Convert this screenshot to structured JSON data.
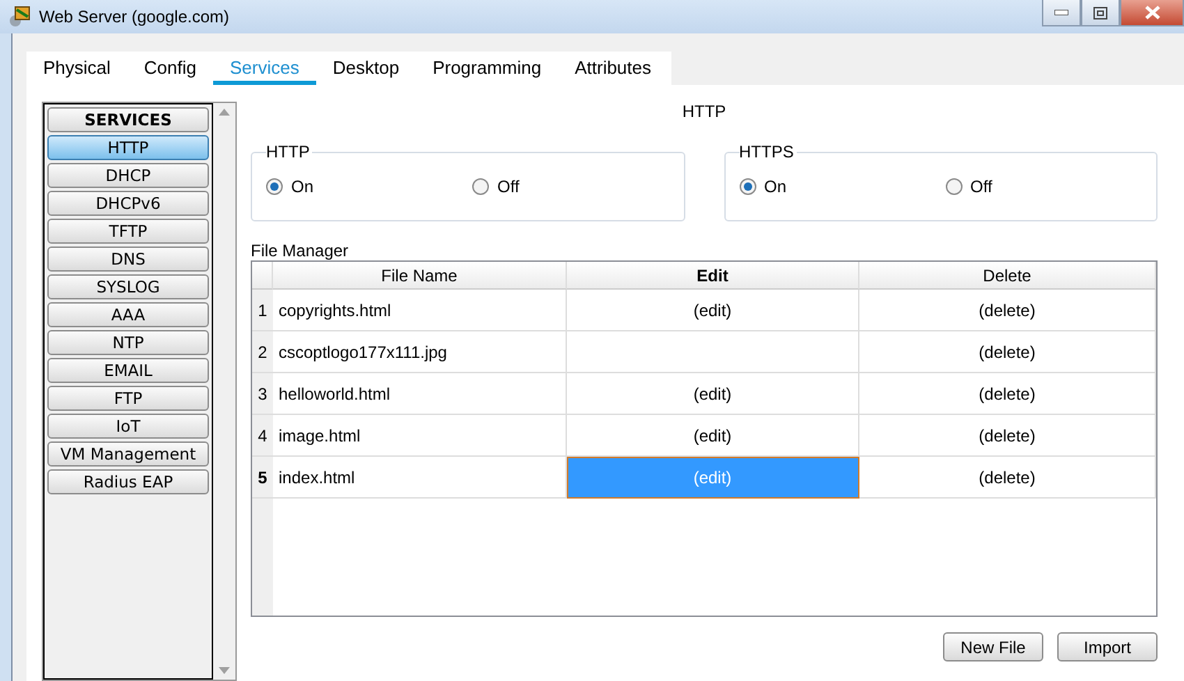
{
  "window": {
    "title": "Web Server (google.com)"
  },
  "tabs": [
    {
      "label": "Physical",
      "selected": false
    },
    {
      "label": "Config",
      "selected": false
    },
    {
      "label": "Services",
      "selected": true
    },
    {
      "label": "Desktop",
      "selected": false
    },
    {
      "label": "Programming",
      "selected": false
    },
    {
      "label": "Attributes",
      "selected": false
    }
  ],
  "sidebar": {
    "header": "SERVICES",
    "items": [
      {
        "label": "HTTP",
        "selected": true
      },
      {
        "label": "DHCP",
        "selected": false
      },
      {
        "label": "DHCPv6",
        "selected": false
      },
      {
        "label": "TFTP",
        "selected": false
      },
      {
        "label": "DNS",
        "selected": false
      },
      {
        "label": "SYSLOG",
        "selected": false
      },
      {
        "label": "AAA",
        "selected": false
      },
      {
        "label": "NTP",
        "selected": false
      },
      {
        "label": "EMAIL",
        "selected": false
      },
      {
        "label": "FTP",
        "selected": false
      },
      {
        "label": "IoT",
        "selected": false
      },
      {
        "label": "VM Management",
        "selected": false
      },
      {
        "label": "Radius EAP",
        "selected": false
      }
    ]
  },
  "panel_title": "HTTP",
  "groups": [
    {
      "title": "HTTP",
      "options": [
        {
          "label": "On",
          "selected": true
        },
        {
          "label": "Off",
          "selected": false
        }
      ]
    },
    {
      "title": "HTTPS",
      "options": [
        {
          "label": "On",
          "selected": true
        },
        {
          "label": "Off",
          "selected": false
        }
      ]
    }
  ],
  "file_manager": {
    "title": "File Manager",
    "columns": [
      "File Name",
      "Edit",
      "Delete"
    ],
    "rows": [
      {
        "number": "1",
        "file_name": "copyrights.html",
        "edit": "(edit)",
        "delete": "(delete)",
        "selected": false
      },
      {
        "number": "2",
        "file_name": "cscoptlogo177x111.jpg",
        "delete": "(delete)",
        "selected": false
      },
      {
        "number": "3",
        "file_name": "helloworld.html",
        "edit": "(edit)",
        "delete": "(delete)",
        "selected": false
      },
      {
        "number": "4",
        "file_name": "image.html",
        "edit": "(edit)",
        "delete": "(delete)",
        "selected": false
      },
      {
        "number": "5",
        "file_name": "index.html",
        "edit": "(edit)",
        "delete": "(delete)",
        "selected": true
      }
    ]
  },
  "buttons": [
    "New File",
    "Import"
  ]
}
